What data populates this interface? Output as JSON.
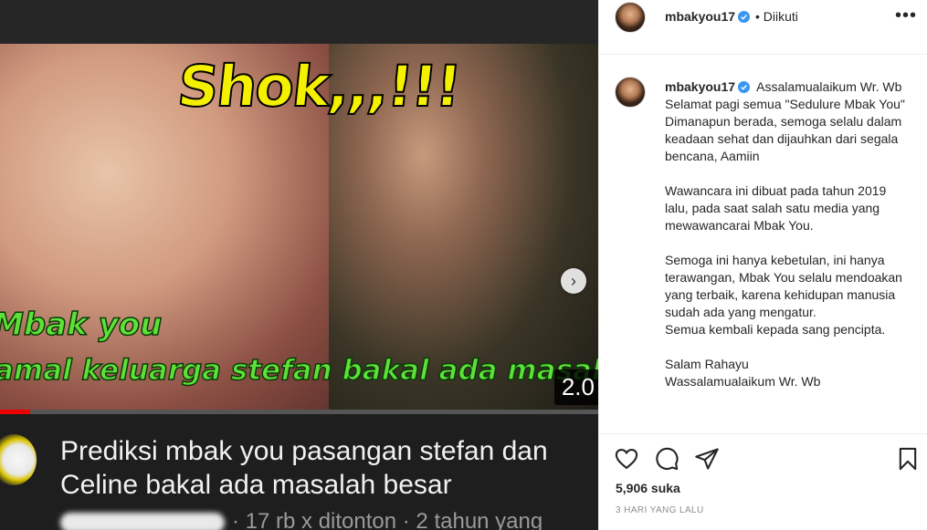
{
  "media": {
    "thumbnail_headline": "Shok,,,!!!",
    "thumbnail_caption_1": "Mbak you",
    "thumbnail_caption_2": "amal keluarga stefan bakal ada masalah besar",
    "duration": "2.0",
    "progress_fraction": 0.05,
    "video_title": "Prediksi mbak you pasangan stefan dan Celine bakal ada masalah besar",
    "video_meta": "· 17 rb x ditonton · 2 tahun yang"
  },
  "post": {
    "username": "mbakyou17",
    "follow_status": "• Diikuti",
    "caption_lines": [
      "Assalamualaikum Wr. Wb",
      "Selamat pagi semua \"Sedulure Mbak You\"",
      "Dimanapun berada, semoga selalu dalam keadaan sehat dan dijauhkan dari segala bencana, Aamiin",
      "",
      "Wawancara ini dibuat pada tahun 2019 lalu, pada saat salah satu media yang mewawancarai Mbak You.",
      "",
      "Semoga ini hanya kebetulan, ini hanya terawangan, Mbak You selalu mendoakan yang terbaik, karena kehidupan manusia sudah ada yang mengatur.",
      "Semua kembali kepada sang pencipta.",
      "",
      "Salam Rahayu",
      "Wassalamualaikum Wr. Wb"
    ],
    "likes": "5,906 suka",
    "timestamp": "3 HARI YANG LALU"
  },
  "icons": [
    "more-icon",
    "verified-icon",
    "heart-icon",
    "comment-icon",
    "share-icon",
    "bookmark-icon",
    "next-icon"
  ],
  "colors": {
    "verified": "#3897f0",
    "text": "#262626",
    "muted": "#8e8e8e",
    "progress": "#ee0000"
  }
}
